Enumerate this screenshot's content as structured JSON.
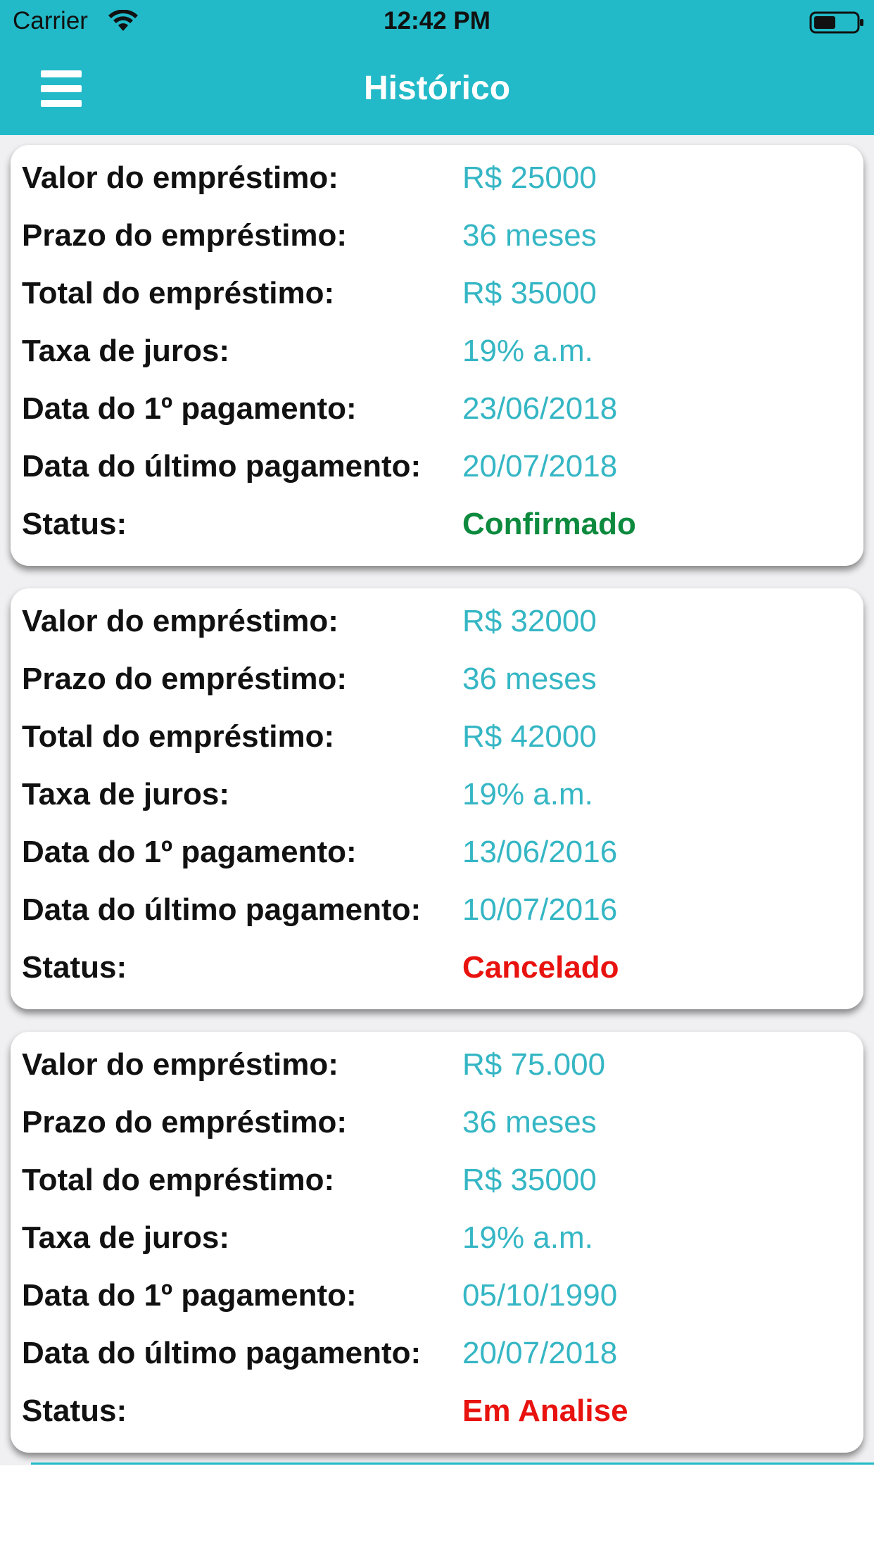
{
  "status_bar": {
    "carrier": "Carrier",
    "time": "12:42 PM"
  },
  "header": {
    "title": "Histórico",
    "menu_icon": "hamburger-menu-icon"
  },
  "colors": {
    "header": "#22bac8",
    "value": "#35b6c4",
    "confirmed": "#0d8a3e",
    "cancelled": "#e8120f",
    "analysis": "#e8120f"
  },
  "labels": {
    "valor": "Valor do empréstimo:",
    "prazo": "Prazo do empréstimo:",
    "total": "Total do empréstimo:",
    "taxa": "Taxa de juros:",
    "primeiro": "Data do 1º pagamento:",
    "ultimo": "Data do último pagamento:",
    "status": "Status:"
  },
  "loans": [
    {
      "valor": "R$ 25000",
      "prazo": "36 meses",
      "total": "R$ 35000",
      "taxa": "19% a.m.",
      "primeiro": "23/06/2018",
      "ultimo": "20/07/2018",
      "status": "Confirmado",
      "status_color": "#0d8a3e"
    },
    {
      "valor": "R$ 32000",
      "prazo": "36 meses",
      "total": "R$ 42000",
      "taxa": "19% a.m.",
      "primeiro": "13/06/2016",
      "ultimo": "10/07/2016",
      "status": "Cancelado",
      "status_color": "#e8120f"
    },
    {
      "valor": "R$ 75.000",
      "prazo": "36 meses",
      "total": "R$ 35000",
      "taxa": "19% a.m.",
      "primeiro": "05/10/1990",
      "ultimo": "20/07/2018",
      "status": "Em Analise",
      "status_color": "#e8120f"
    }
  ]
}
